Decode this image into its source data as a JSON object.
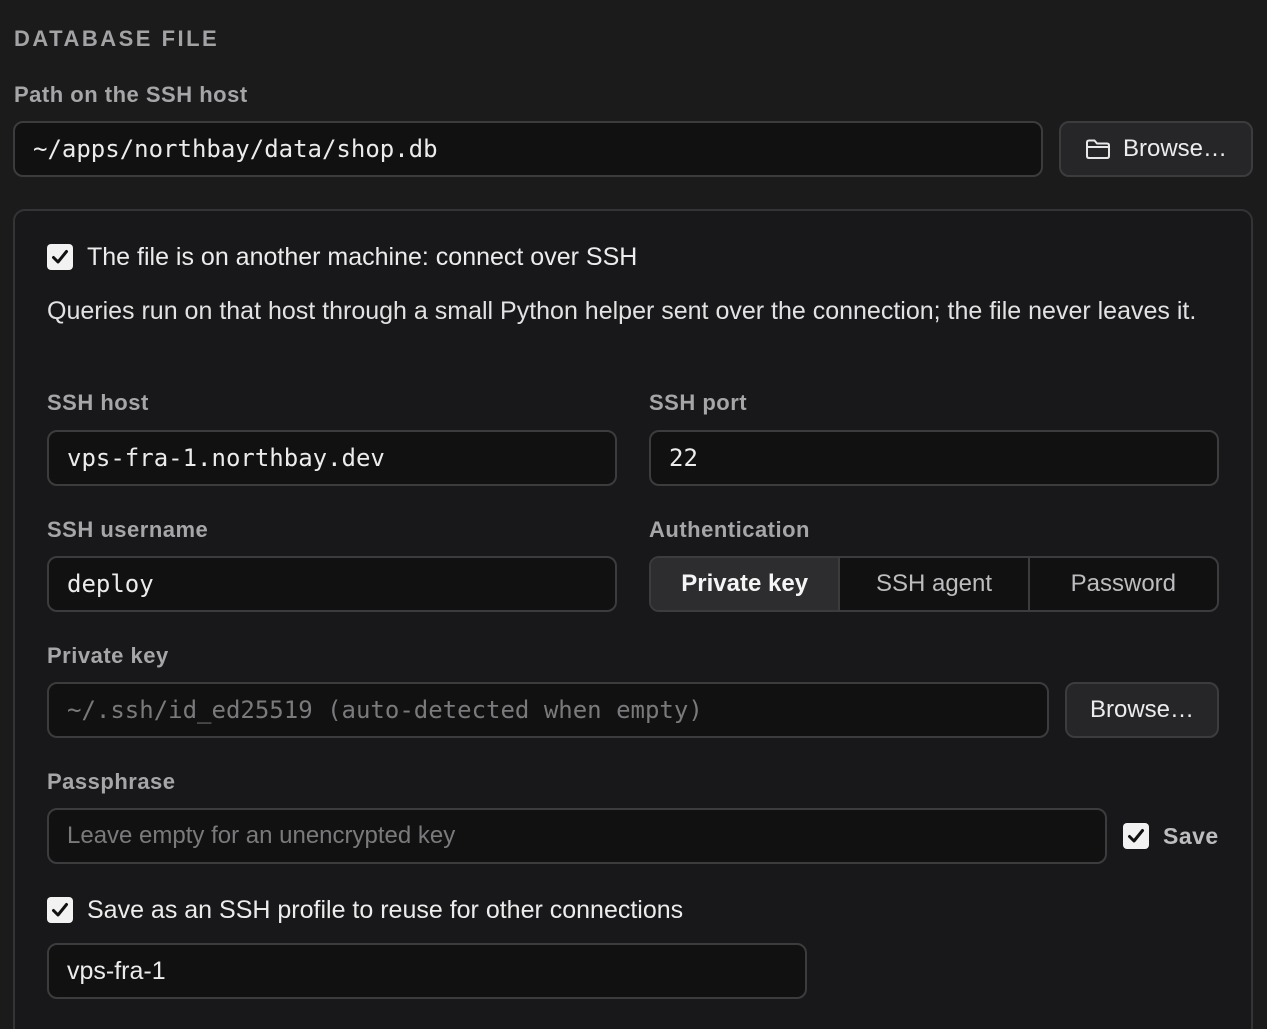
{
  "section": {
    "title": "DATABASE FILE"
  },
  "path": {
    "label": "Path on the SSH host",
    "value": "~/apps/northbay/data/shop.db",
    "browse_label": "Browse…"
  },
  "ssh": {
    "enabled_label": "The file is on another machine: connect over SSH",
    "enabled": true,
    "description": "Queries run on that host through a small Python helper sent over the connection; the file never leaves it.",
    "host_label": "SSH host",
    "host_value": "vps-fra-1.northbay.dev",
    "port_label": "SSH port",
    "port_value": "22",
    "username_label": "SSH username",
    "username_value": "deploy",
    "auth_label": "Authentication",
    "auth_options": [
      "Private key",
      "SSH agent",
      "Password"
    ],
    "auth_selected": "Private key",
    "key_label": "Private key",
    "key_placeholder": "~/.ssh/id_ed25519 (auto-detected when empty)",
    "key_browse_label": "Browse…",
    "passphrase_label": "Passphrase",
    "passphrase_placeholder": "Leave empty for an unencrypted key",
    "passphrase_save_label": "Save",
    "passphrase_save_checked": true,
    "profile_label": "Save as an SSH profile to reuse for other connections",
    "profile_checked": true,
    "profile_value": "vps-fra-1"
  },
  "colors": {
    "background": "#1b1b1c",
    "input_background": "#111112",
    "border": "#3c3c3f",
    "checkbox": "#f2f2f2"
  }
}
